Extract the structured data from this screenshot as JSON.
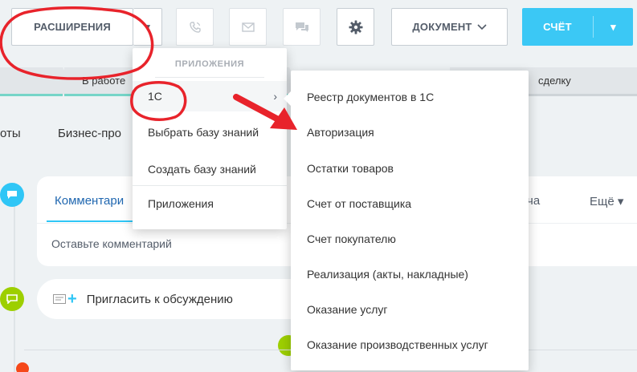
{
  "toolbar": {
    "extensions_label": "РАСШИРЕНИЯ",
    "document_label": "ДОКУМЕНТ",
    "invoice_label": "СЧЁТ",
    "caret": "▾",
    "chevron": "⌄",
    "phone_icon": "phone-icon",
    "mail_icon": "mail-icon",
    "chat_icon": "chat-icon",
    "gear_icon": "gear-icon"
  },
  "stages": {
    "in_progress": "В работе",
    "deal_fragment": "сделку"
  },
  "tabs_row": {
    "left_fragment": "оты",
    "business": "Бизнес-про"
  },
  "comment_panel": {
    "tab_comment": "Комментари",
    "tab_right_fragment": "ча",
    "more": "Ещё ▾",
    "placeholder": "Оставьте комментарий"
  },
  "invite": {
    "text": "Пригласить к обсуждению"
  },
  "menu1": {
    "header": "ПРИЛОЖЕНИЯ",
    "items": [
      {
        "label": "1С",
        "has_submenu": true
      },
      {
        "label": "Выбрать базу знаний"
      },
      {
        "label": "Создать базу знаний"
      },
      {
        "label": "Приложения"
      }
    ],
    "chevron": "›"
  },
  "submenu": {
    "items": [
      "Реестр документов в 1С",
      "Авторизация",
      "Остатки товаров",
      "Счет от поставщика",
      "Счет покупателю",
      "Реализация (акты, накладные)",
      "Оказание услуг",
      "Оказание производственных услуг"
    ]
  },
  "colors": {
    "accent": "#3bc8f5",
    "annotation": "#e8232b",
    "timeline_blue": "#2fc6f6",
    "timeline_green": "#9dcf00"
  }
}
